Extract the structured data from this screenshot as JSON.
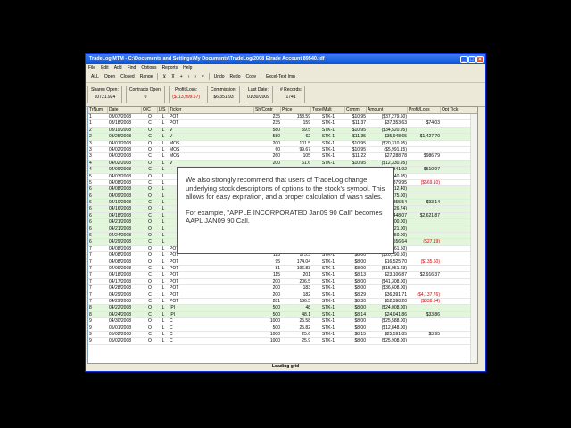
{
  "window": {
    "title": "TradeLog MTM  -  C:\\Documents and Settings\\My Documents\\TradeLog\\2008 Etrade Account 89540.tdf"
  },
  "menu": [
    "File",
    "Edit",
    "Add",
    "Find",
    "Options",
    "Reports",
    "Help"
  ],
  "toolbar": {
    "filters": [
      "ALL",
      "Open",
      "Closed",
      "Range"
    ],
    "actions": [
      "Undo",
      "Redo",
      "Copy"
    ],
    "excel": "Excel-Text Imp"
  },
  "summary": [
    {
      "label": "Shares Open:",
      "value": "10721.924"
    },
    {
      "label": "Contracts Open:",
      "value": "0"
    },
    {
      "label": "Profit/Loss:",
      "value": "($113,999.67)",
      "red": true
    },
    {
      "label": "Commission:",
      "value": "$6,351.93"
    },
    {
      "label": "Last Date:",
      "value": "01/30/2009"
    },
    {
      "label": "# Records:",
      "value": "1741"
    }
  ],
  "columns": [
    "TrNum",
    "Date",
    "O/C",
    "L/S",
    "Ticker",
    "Sh/Contr",
    "Price",
    "Type/Mult",
    "Comm",
    "Amount",
    "Profit/Loss",
    "Opt Tick"
  ],
  "rows": [
    [
      "1",
      "03/07/2008",
      "O",
      "L",
      "POT",
      "235",
      "158.59",
      "STK-1",
      "$10.95",
      "($37,279.60)",
      "",
      ""
    ],
    [
      "1",
      "03/18/2008",
      "C",
      "L",
      "POT",
      "235",
      "159",
      "STK-1",
      "$11.37",
      "$37,353.63",
      "$74.03",
      ""
    ],
    [
      "2",
      "03/19/2008",
      "O",
      "L",
      "V",
      "580",
      "59.5",
      "STK-1",
      "$10.95",
      "($34,520.95)",
      "",
      ""
    ],
    [
      "2",
      "03/25/2008",
      "C",
      "L",
      "V",
      "580",
      "62",
      "STK-1",
      "$11.35",
      "$35,948.65",
      "$1,427.70",
      ""
    ],
    [
      "3",
      "04/01/2008",
      "O",
      "L",
      "MOS",
      "200",
      "101.5",
      "STK-1",
      "$10.95",
      "($20,310.95)",
      "",
      ""
    ],
    [
      "3",
      "04/02/2008",
      "O",
      "L",
      "MOS",
      "60",
      "99.67",
      "STK-1",
      "$10.95",
      "($5,991.15)",
      "",
      ""
    ],
    [
      "3",
      "04/03/2008",
      "C",
      "L",
      "MOS",
      "260",
      "105",
      "STK-1",
      "$11.22",
      "$27,288.78",
      "$986.79",
      ""
    ],
    [
      "4",
      "04/02/2008",
      "O",
      "L",
      "V",
      "200",
      "61.6",
      "STK-1",
      "$10.95",
      "($12,330.95)",
      "",
      ""
    ],
    [
      "4",
      "04/09/2008",
      "C",
      "L",
      "",
      "",
      "",
      "",
      "",
      "$12,841.92",
      "$510.97",
      ""
    ],
    [
      "5",
      "04/03/2008",
      "O",
      "L",
      "",
      "",
      "",
      "",
      "",
      "($26,440.95)",
      "",
      ""
    ],
    [
      "5",
      "04/08/2008",
      "C",
      "L",
      "",
      "",
      "",
      "",
      "",
      "$25,879.95",
      "($569.10)",
      ""
    ],
    [
      "6",
      "04/08/2008",
      "O",
      "L",
      "",
      "",
      "",
      "",
      "",
      "($12,412.40)",
      "",
      ""
    ],
    [
      "6",
      "04/09/2008",
      "O",
      "L",
      "",
      "",
      "",
      "",
      "",
      "($6,375.00)",
      "",
      ""
    ],
    [
      "6",
      "04/10/2008",
      "C",
      "L",
      "",
      "",
      "",
      "",
      "",
      "$18,855.54",
      "$93.14",
      ""
    ],
    [
      "6",
      "04/16/2008",
      "O",
      "L",
      "",
      "",
      "",
      "",
      "",
      "($19,826.74)",
      "",
      ""
    ],
    [
      "6",
      "04/18/2008",
      "C",
      "L",
      "",
      "",
      "",
      "",
      "",
      "$22,448.07",
      "$2,621.87",
      ""
    ],
    [
      "6",
      "04/21/2008",
      "O",
      "L",
      "",
      "",
      "",
      "",
      "",
      "($21,000.00)",
      "",
      ""
    ],
    [
      "6",
      "04/21/2008",
      "O",
      "L",
      "",
      "",
      "",
      "",
      "",
      "($16,421.00)",
      "",
      ""
    ],
    [
      "6",
      "04/24/2008",
      "O",
      "L",
      "",
      "",
      "",
      "",
      "",
      "($5,250.00)",
      "",
      ""
    ],
    [
      "6",
      "04/29/2008",
      "C",
      "L",
      "",
      "",
      "",
      "",
      "",
      "$42,556.64",
      "($27.19)",
      ""
    ],
    [
      "7",
      "04/08/2008",
      "O",
      "L",
      "POT",
      "",
      "",
      "",
      "",
      "($16,661.50)",
      "",
      ""
    ],
    [
      "7",
      "04/08/2008",
      "O",
      "L",
      "POT",
      "115",
      "175.5",
      "STK-1",
      "$8.00",
      "($20,190.50)",
      "",
      ""
    ],
    [
      "7",
      "04/08/2008",
      "O",
      "L",
      "POT",
      "95",
      "174.04",
      "STK-1",
      "$8.00",
      "$16,525.70",
      "($135.60)",
      ""
    ],
    [
      "7",
      "04/09/2008",
      "C",
      "L",
      "POT",
      "81",
      "196.83",
      "STK-1",
      "$8.00",
      "($15,951.23)",
      "",
      ""
    ],
    [
      "7",
      "04/18/2008",
      "C",
      "L",
      "POT",
      "115",
      "201",
      "STK-1",
      "$8.13",
      "$23,106.87",
      "$2,916.37",
      ""
    ],
    [
      "7",
      "04/17/2008",
      "O",
      "L",
      "POT",
      "200",
      "206.5",
      "STK-1",
      "$8.00",
      "($41,308.00)",
      "",
      ""
    ],
    [
      "7",
      "04/28/2008",
      "O",
      "L",
      "POT",
      "200",
      "183",
      "STK-1",
      "$8.00",
      "($36,608.00)",
      "",
      ""
    ],
    [
      "7",
      "04/29/2008",
      "C",
      "L",
      "POT",
      "200",
      "182",
      "STK-1",
      "$8.29",
      "$36,391.71",
      "($4,137.76)",
      ""
    ],
    [
      "7",
      "04/29/2008",
      "C",
      "L",
      "POT",
      "281",
      "186.5",
      "STK-1",
      "$8.30",
      "$52,398.20",
      "($338.54)",
      ""
    ],
    [
      "8",
      "04/22/2008",
      "O",
      "L",
      "IPI",
      "500",
      "48",
      "STK-1",
      "$8.00",
      "($24,008.00)",
      "",
      ""
    ],
    [
      "8",
      "04/24/2008",
      "C",
      "L",
      "IPI",
      "500",
      "48.1",
      "STK-1",
      "$8.14",
      "$24,041.86",
      "$33.86",
      ""
    ],
    [
      "9",
      "04/30/2008",
      "O",
      "L",
      "C",
      "1000",
      "25.58",
      "STK-1",
      "$8.00",
      "($25,588.00)",
      "",
      ""
    ],
    [
      "9",
      "05/01/2008",
      "O",
      "L",
      "C",
      "500",
      "25.82",
      "STK-1",
      "$8.00",
      "($12,848.00)",
      "",
      ""
    ],
    [
      "9",
      "05/02/2008",
      "C",
      "L",
      "C",
      "1000",
      "25.6",
      "STK-1",
      "$8.15",
      "$25,591.85",
      "$3.95",
      ""
    ],
    [
      "9",
      "05/02/2008",
      "O",
      "L",
      "C",
      "1000",
      "25.9",
      "STK-1",
      "$8.00",
      "($25,908.00)",
      "",
      ""
    ]
  ],
  "status": "Loading grid",
  "tooltip": {
    "p1": "We also strongly recommend that users of TradeLog change underlying stock descriptions of options to the stock's symbol. This allows for easy expiration, and a proper calculation of wash sales.",
    "p2": "For example, \"APPLE INCORPORATED Jan09 90 Call\" becomes AAPL JAN09 90 Call."
  }
}
